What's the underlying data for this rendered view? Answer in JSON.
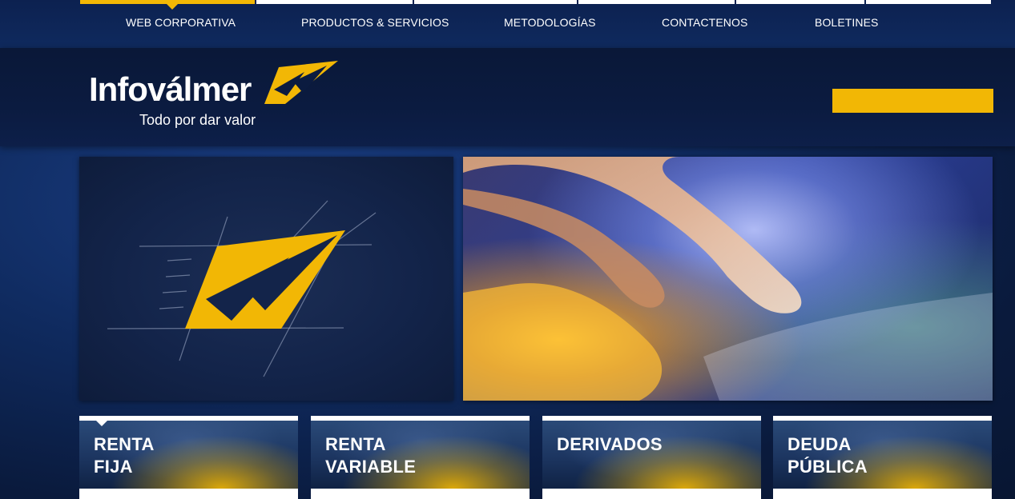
{
  "nav": {
    "items": [
      "WEB CORPORATIVA",
      "PRODUCTOS & SERVICIOS",
      "METODOLOGÍAS",
      "CONTACTENOS",
      "BOLETINES"
    ],
    "active_index": 0
  },
  "brand": {
    "name": "Infoválmer",
    "tagline": "Todo por dar valor"
  },
  "colors": {
    "accent": "#f2b705",
    "navy": "#0f2a5e",
    "white": "#ffffff"
  },
  "cards": [
    {
      "line1": "RENTA",
      "line2": "FIJA"
    },
    {
      "line1": "RENTA",
      "line2": "VARIABLE"
    },
    {
      "line1": "DERIVADOS",
      "line2": ""
    },
    {
      "line1": "DEUDA",
      "line2": "PÚBLICA"
    }
  ]
}
